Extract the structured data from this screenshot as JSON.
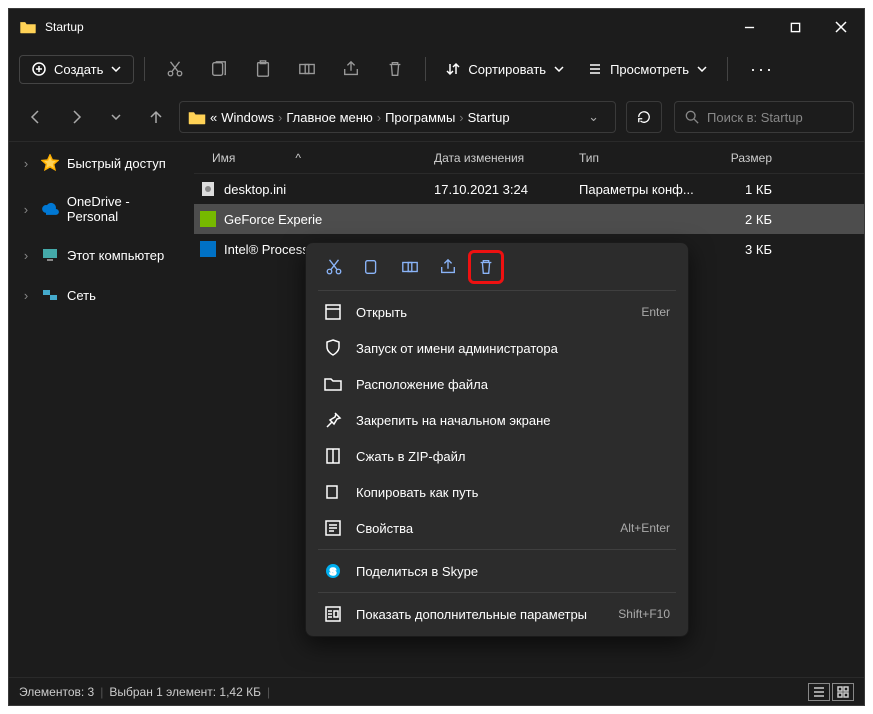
{
  "title": "Startup",
  "toolbar": {
    "create": "Создать",
    "sort": "Сортировать",
    "view": "Просмотреть"
  },
  "breadcrumb": {
    "prefix": "«",
    "parts": [
      "Windows",
      "Главное меню",
      "Программы",
      "Startup"
    ]
  },
  "search": {
    "placeholder": "Поиск в: Startup"
  },
  "sidebar": {
    "quick": "Быстрый доступ",
    "onedrive": "OneDrive - Personal",
    "thispc": "Этот компьютер",
    "network": "Сеть"
  },
  "columns": {
    "name": "Имя",
    "date": "Дата изменения",
    "type": "Тип",
    "size": "Размер"
  },
  "files": [
    {
      "name": "desktop.ini",
      "date": "17.10.2021 3:24",
      "type": "Параметры конф...",
      "size": "1 КБ",
      "icon": "ini",
      "selected": false
    },
    {
      "name": "GeForce Experie",
      "date": "",
      "type": "",
      "size": "2 КБ",
      "icon": "nv",
      "selected": true
    },
    {
      "name": "Intel® Processo",
      "date": "",
      "type": "",
      "size": "3 КБ",
      "icon": "intel",
      "selected": false
    }
  ],
  "status": {
    "items": "Элементов: 3",
    "selected": "Выбран 1 элемент: 1,42 КБ"
  },
  "context": {
    "open": "Открыть",
    "admin": "Запуск от имени администратора",
    "location": "Расположение файла",
    "pin": "Закрепить на начальном экране",
    "zip": "Сжать в ZIP-файл",
    "copypath": "Копировать как путь",
    "properties": "Свойства",
    "skype": "Поделиться в Skype",
    "more": "Показать дополнительные параметры",
    "sc_open": "Enter",
    "sc_props": "Alt+Enter",
    "sc_more": "Shift+F10"
  }
}
